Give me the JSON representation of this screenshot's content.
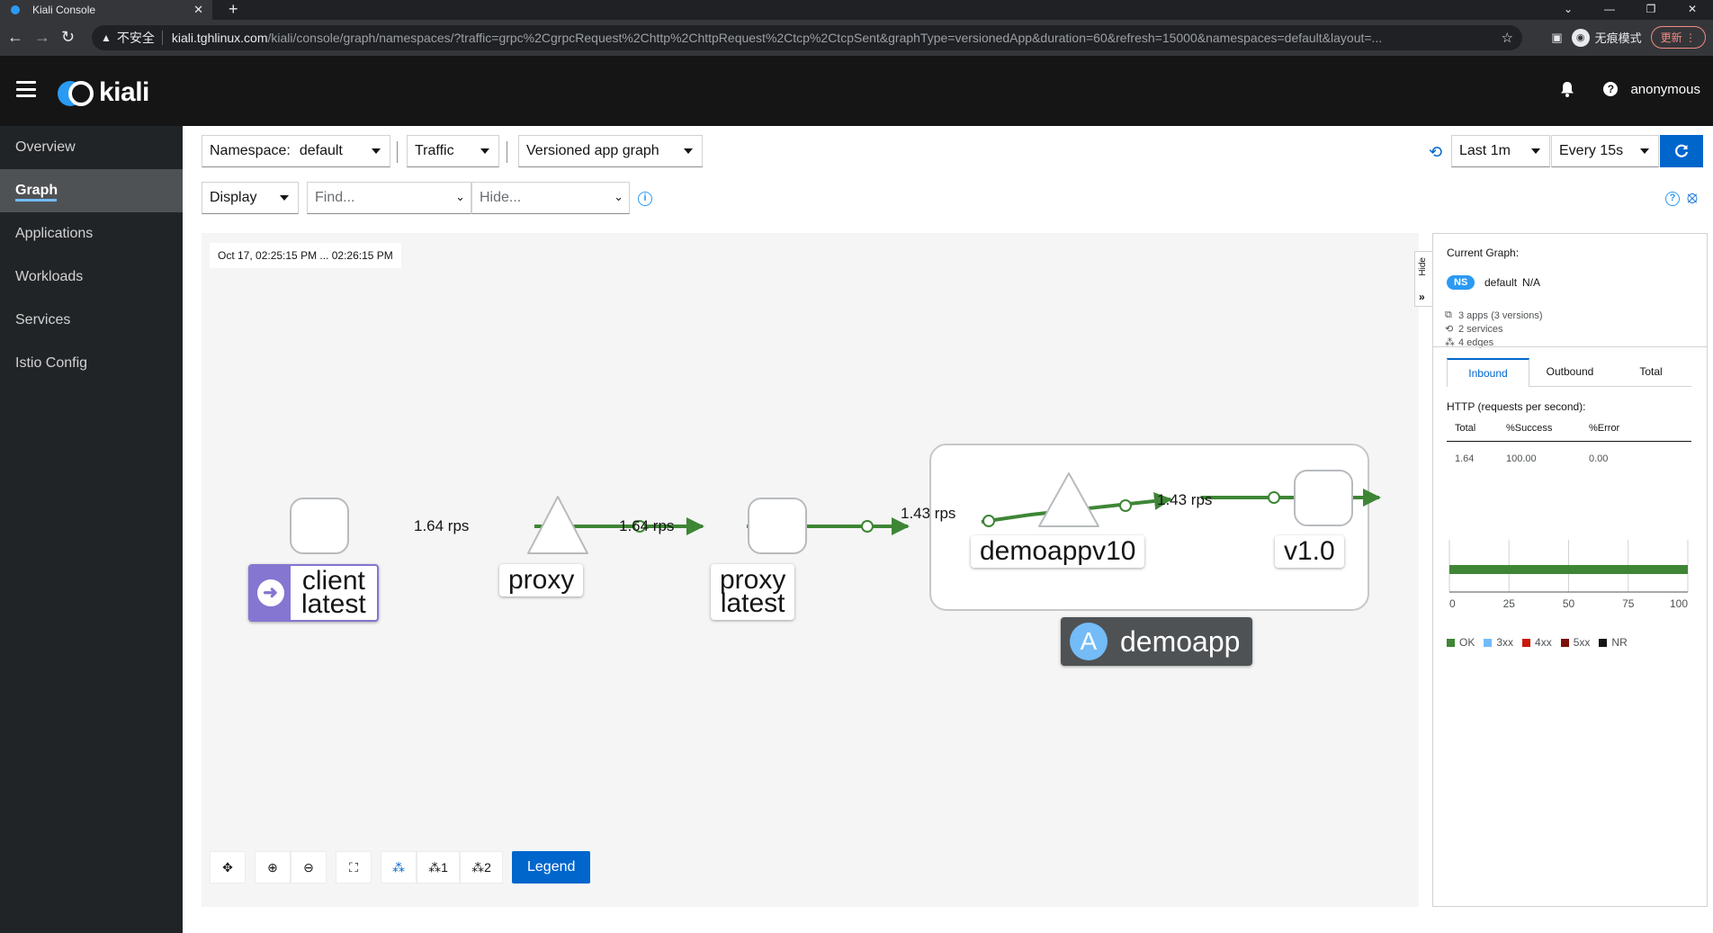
{
  "browser": {
    "tab_title": "Kiali Console",
    "tab_close": "✕",
    "new_tab": "+",
    "insecure_label": "不安全",
    "url_host": "kiali.tghlinux.com",
    "url_path": "/kiali/console/graph/namespaces/?traffic=grpc%2CgrpcRequest%2Chttp%2ChttpRequest%2Ctcp%2CtcpSent&graphType=versionedApp&duration=60&refresh=15000&namespaces=default&layout=...",
    "incognito_label": "无痕模式",
    "update_label": "更新"
  },
  "masthead": {
    "logo_text": "kiali",
    "user": "anonymous"
  },
  "sidebar": {
    "items": [
      {
        "label": "Overview"
      },
      {
        "label": "Graph"
      },
      {
        "label": "Applications"
      },
      {
        "label": "Workloads"
      },
      {
        "label": "Services"
      },
      {
        "label": "Istio Config"
      }
    ],
    "active": "Graph"
  },
  "toolbar": {
    "namespace_key": "Namespace:",
    "namespace_value": "default",
    "traffic": "Traffic",
    "graph_type": "Versioned app graph",
    "display": "Display",
    "find_placeholder": "Find...",
    "hide_placeholder": "Hide...",
    "duration": "Last 1m",
    "refresh_interval": "Every 15s"
  },
  "graph": {
    "timestamp": "Oct 17, 02:25:15 PM ... 02:26:15 PM",
    "nodes": {
      "client": "client\nlatest",
      "proxy_service": "proxy",
      "proxy_workload": "proxy\nlatest",
      "demo_service": "demoappv10",
      "demo_version": "v1.0",
      "app_box": "demoapp",
      "app_badge": "A"
    },
    "edges": [
      {
        "label": "1.64 rps"
      },
      {
        "label": "1.64 rps"
      },
      {
        "label": "1.43 rps"
      },
      {
        "label": "1.43 rps"
      }
    ],
    "edge_color": "#3e8635",
    "toolbar": {
      "layout1_label": "1",
      "layout2_label": "2",
      "legend": "Legend"
    }
  },
  "side_panel": {
    "hide_label": "Hide",
    "current_graph": "Current Graph:",
    "ns_badge": "NS",
    "namespace": "default",
    "namespace_extra": "N/A",
    "apps": "3 apps (3 versions)",
    "services": "2 services",
    "edges": "4 edges",
    "tabs": [
      "Inbound",
      "Outbound",
      "Total"
    ],
    "http_title": "HTTP (requests per second):",
    "table_headers": [
      "Total",
      "%Success",
      "%Error"
    ],
    "table_values": [
      "1.64",
      "100.00",
      "0.00"
    ],
    "chart_ticks": [
      "0",
      "25",
      "50",
      "75",
      "100"
    ],
    "ok_percent": 100,
    "legend": [
      {
        "label": "OK",
        "color": "#3e8635"
      },
      {
        "label": "3xx",
        "color": "#73bcf7"
      },
      {
        "label": "4xx",
        "color": "#c9190b"
      },
      {
        "label": "5xx",
        "color": "#7d1007"
      },
      {
        "label": "NR",
        "color": "#151515"
      }
    ]
  }
}
